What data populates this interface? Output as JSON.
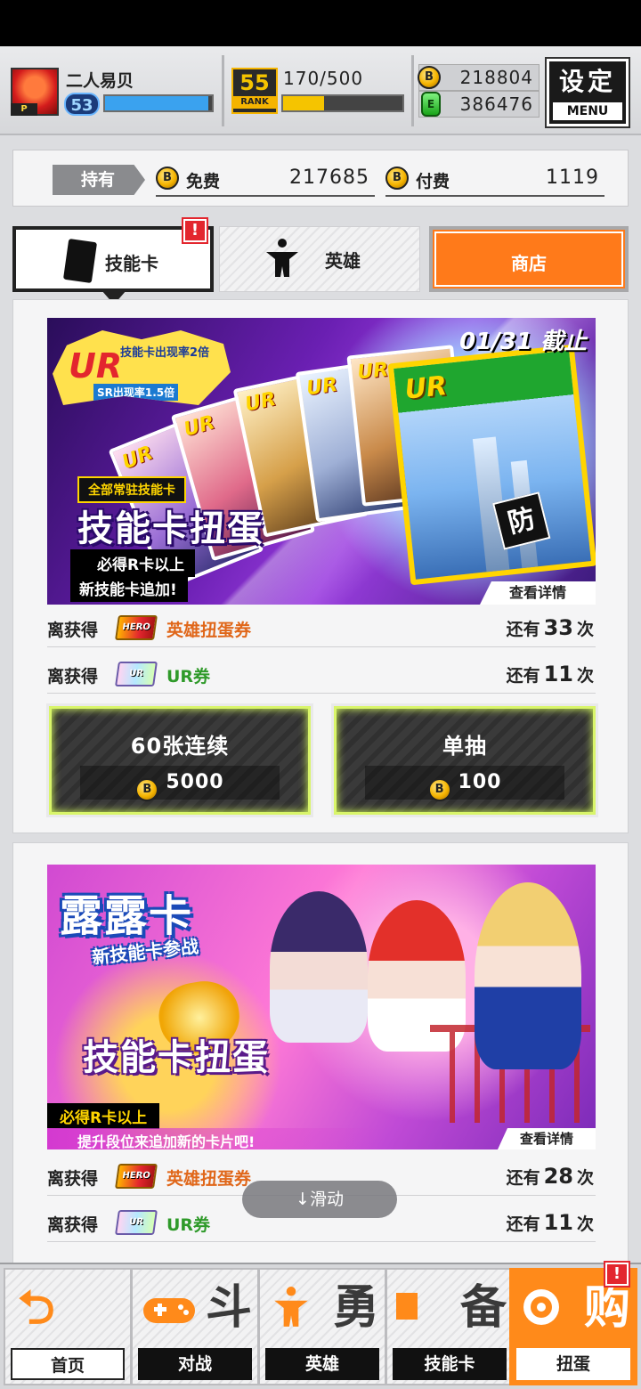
{
  "header": {
    "player_name": "二人易贝",
    "player_rank_tag": "P",
    "level": "53",
    "rank_number": "55",
    "rank_label": "RANK",
    "stamina": "170/500",
    "stamina_fraction": 0.34,
    "exp_fraction": 0.97,
    "coins": "218804",
    "gems": "386476",
    "coin_glyph": "B",
    "gem_glyph": "E",
    "menu_title": "设定",
    "menu_label": "MENU"
  },
  "holdings": {
    "tag": "持有",
    "free_label": "免费",
    "free_value": "217685",
    "paid_label": "付费",
    "paid_value": "1119"
  },
  "tabs": {
    "skill_card": "技能卡",
    "hero": "英雄",
    "shop": "商店",
    "alert": "!"
  },
  "gacha1": {
    "ur_big": "UR",
    "ur_note": "技能卡出现率2倍",
    "sr_note": "SR出现率1.5倍",
    "deadline": "01/31 截止",
    "subtitle": "全部常驻技能卡",
    "title": "技能卡扭蛋",
    "line1": "必得R卡以上",
    "line2": "新技能卡追加!",
    "def_glyph": "防",
    "detail": "查看详情",
    "rewards": [
      {
        "label": "离获得",
        "ticket": "HERO",
        "item": "英雄扭蛋券",
        "prefix": "还有",
        "count": "33",
        "suffix": "次"
      },
      {
        "label": "离获得",
        "ticket": "UR",
        "item": "UR券",
        "prefix": "还有",
        "count": "11",
        "suffix": "次"
      }
    ],
    "multi": {
      "label": "60张连续",
      "cost": "5000"
    },
    "single": {
      "label": "单抽",
      "cost": "100"
    }
  },
  "gacha2": {
    "headline": "露露卡",
    "headline_sub": "新技能卡参战",
    "title": "技能卡扭蛋",
    "line1": "必得R卡以上",
    "line2": "提升段位来追加新的卡片吧!",
    "detail": "查看详情",
    "rewards": [
      {
        "label": "离获得",
        "ticket": "HERO",
        "item": "英雄扭蛋券",
        "prefix": "还有",
        "count": "28",
        "suffix": "次"
      },
      {
        "label": "离获得",
        "ticket": "UR",
        "item": "UR券",
        "prefix": "还有",
        "count": "11",
        "suffix": "次"
      }
    ]
  },
  "scroll_hint": "↓滑动",
  "nav": [
    {
      "label": "首页",
      "glyph": "⮌"
    },
    {
      "label": "对战",
      "glyph": "斗"
    },
    {
      "label": "英雄",
      "glyph": "勇"
    },
    {
      "label": "技能卡",
      "glyph": "备"
    },
    {
      "label": "扭蛋",
      "glyph": "购"
    }
  ],
  "colors": {
    "accent_orange": "#ff7a1a",
    "exp_blue": "#3aa2ef",
    "stamina_yellow": "#f5c400",
    "reward_orange": "#e0671a",
    "reward_green": "#2f9a2a"
  }
}
